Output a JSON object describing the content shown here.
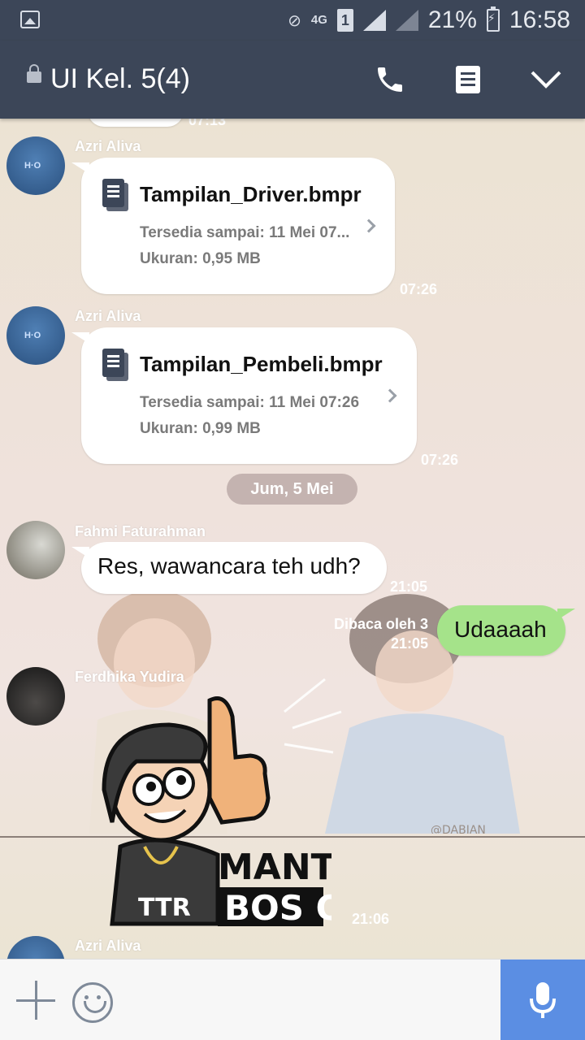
{
  "status_bar": {
    "battery_percent": "21%",
    "time": "16:58",
    "network": "4G",
    "sim": "1"
  },
  "header": {
    "title": "UI Kel. 5(4)"
  },
  "messages": {
    "prev_time": "07:13",
    "file1": {
      "sender": "Azri Aliva",
      "name": "Tampilan_Driver.bmpr",
      "available": "Tersedia sampai: 11 Mei 07...",
      "size": "Ukuran: 0,95 MB",
      "time": "07:26"
    },
    "file2": {
      "sender": "Azri Aliva",
      "name": "Tampilan_Pembeli.bmpr",
      "available": "Tersedia sampai: 11 Mei 07:26",
      "size": "Ukuran: 0,99 MB",
      "time": "07:26"
    },
    "date_divider": "Jum, 5 Mei",
    "text1": {
      "sender": "Fahmi Faturahman",
      "text": "Res, wawancara teh udh?",
      "time": "21:05"
    },
    "own1": {
      "read": "Dibaca oleh 3",
      "time": "21:05",
      "text": "Udaaaah"
    },
    "sticker1": {
      "sender": "Ferdhika Yudira",
      "line1": "MANTAP",
      "line2": "BOS Q",
      "tag": "TTR",
      "time": "21:06"
    },
    "next_sender": "Azri Aliva"
  },
  "colors": {
    "header_bg": "#3c4658",
    "own_bubble": "#a5e38a",
    "mic_button": "#5b8ee3"
  }
}
